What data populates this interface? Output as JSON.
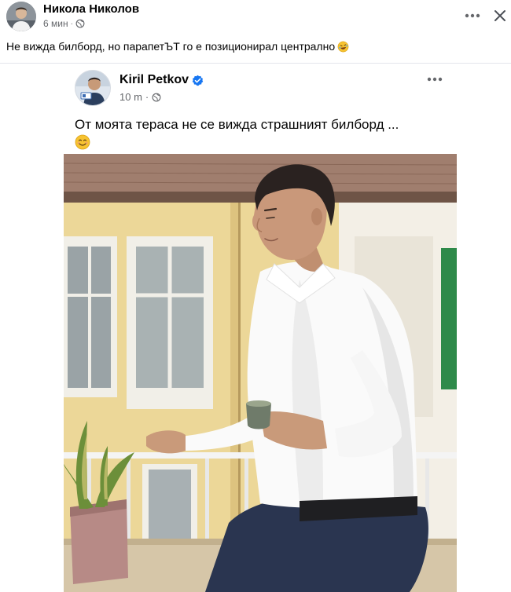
{
  "post": {
    "author": "Никола Николов",
    "time": "6 мин",
    "caption": "Не вижда билборд, но парапетЪТ го е позиционирал централно",
    "icons": {
      "more": "more-horizontal-icon",
      "close": "close-icon",
      "audience": "globe-icon",
      "reaction": "rofl-emoji-icon"
    }
  },
  "shared": {
    "author": "Kiril Petkov",
    "time": "10 m",
    "text": "От моята тераса не се вижда страшният билборд ...",
    "icons": {
      "verified": "verified-badge-icon",
      "more": "more-horizontal-icon",
      "audience": "globe-icon",
      "emoji": "smiling-face-emoji-icon"
    },
    "photo_alt": ""
  },
  "colors": {
    "text": "#050505",
    "muted": "#65676b",
    "verified": "#1877f2",
    "divider": "#e4e6eb"
  }
}
